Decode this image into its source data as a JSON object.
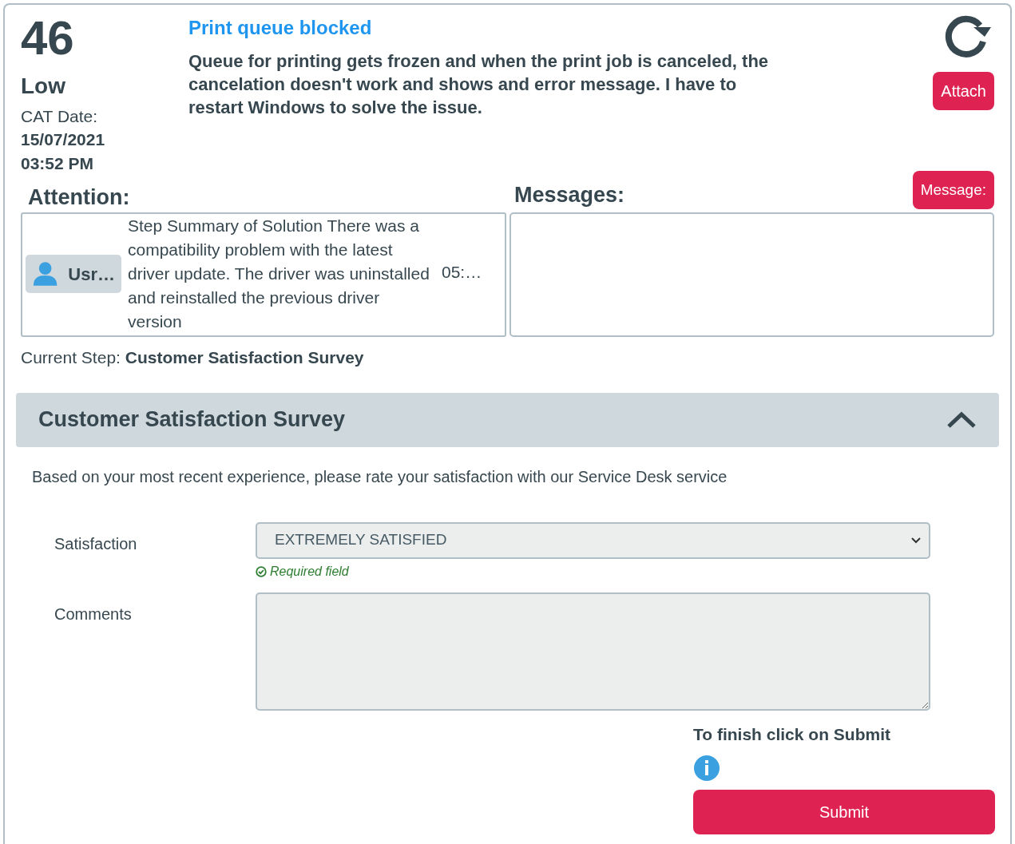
{
  "ticket": {
    "number": "46",
    "priority": "Low",
    "date_label": "CAT Date:",
    "date": "15/07/2021",
    "time": "03:52 PM",
    "title": "Print queue blocked",
    "description": "Queue for printing gets frozen and when the print job is canceled, the cancelation doesn't work and shows and error message. I have to restart Windows to solve the issue.",
    "attach_button": "Attach"
  },
  "attention": {
    "heading": "Attention:",
    "entries": [
      {
        "user": "Usr…",
        "text": "Step Summary of Solution There was a compatibility problem with the latest driver update. The driver was uninstalled and reinstalled the previous driver version",
        "time": "05:…"
      }
    ]
  },
  "messages": {
    "heading": "Messages:",
    "button": "Message:"
  },
  "current_step": {
    "label": "Current Step:",
    "value": "Customer Satisfaction Survey"
  },
  "survey": {
    "title": "Customer Satisfaction Survey",
    "expanded": true,
    "intro": "Based on your most recent experience, please rate your satisfaction with our Service Desk service",
    "fields": [
      {
        "kind": "select",
        "label": "Satisfaction",
        "value": "EXTREMELY SATISFIED",
        "hint": "Required field"
      },
      {
        "kind": "textarea",
        "label": "Comments"
      }
    ],
    "finish_text": "To finish click on Submit",
    "submit": "Submit"
  }
}
